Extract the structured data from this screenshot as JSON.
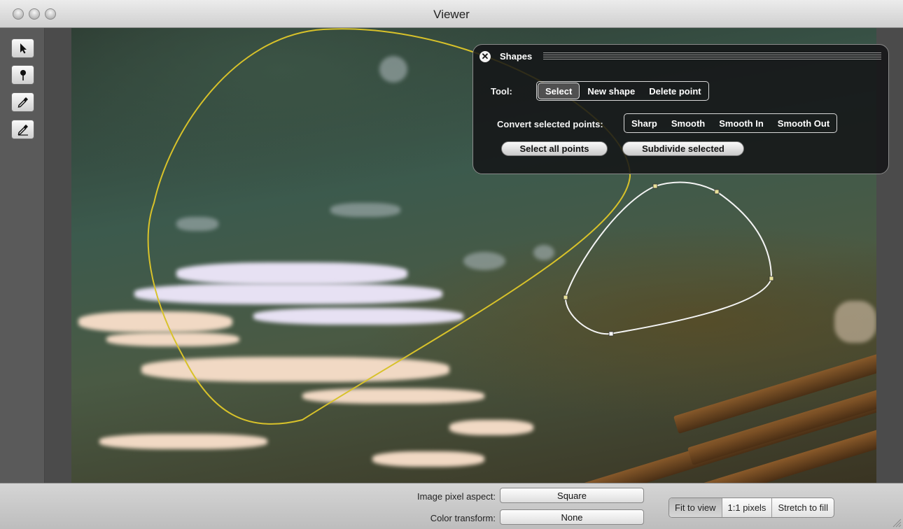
{
  "window": {
    "title": "Viewer",
    "controls": [
      "close-button",
      "minimize-button",
      "zoom-button"
    ]
  },
  "toolbar": {
    "tools": [
      {
        "name": "select-arrow-icon"
      },
      {
        "name": "pin-icon"
      },
      {
        "name": "eyedropper-icon"
      },
      {
        "name": "eyedropper-plus-icon"
      }
    ]
  },
  "shapes_panel": {
    "title": "Shapes",
    "tool_label": "Tool:",
    "tools": [
      "Select",
      "New shape",
      "Delete point"
    ],
    "selected_tool": "Select",
    "convert_label": "Convert selected points:",
    "convert_options": [
      "Sharp",
      "Smooth",
      "Smooth In",
      "Smooth Out"
    ],
    "select_all_label": "Select all points",
    "subdivide_label": "Subdivide selected"
  },
  "bottom_bar": {
    "pixel_aspect_label": "Image pixel aspect:",
    "pixel_aspect_value": "Square",
    "color_transform_label": "Color transform:",
    "color_transform_value": "None",
    "view_modes": [
      "Fit to view",
      "1:1 pixels",
      "Stretch to fill"
    ],
    "selected_view_mode": "Fit to view"
  },
  "colors": {
    "shape_active": "#d8c22a",
    "shape_selected": "#f4f4f4",
    "control_point": "#e8e29a"
  }
}
